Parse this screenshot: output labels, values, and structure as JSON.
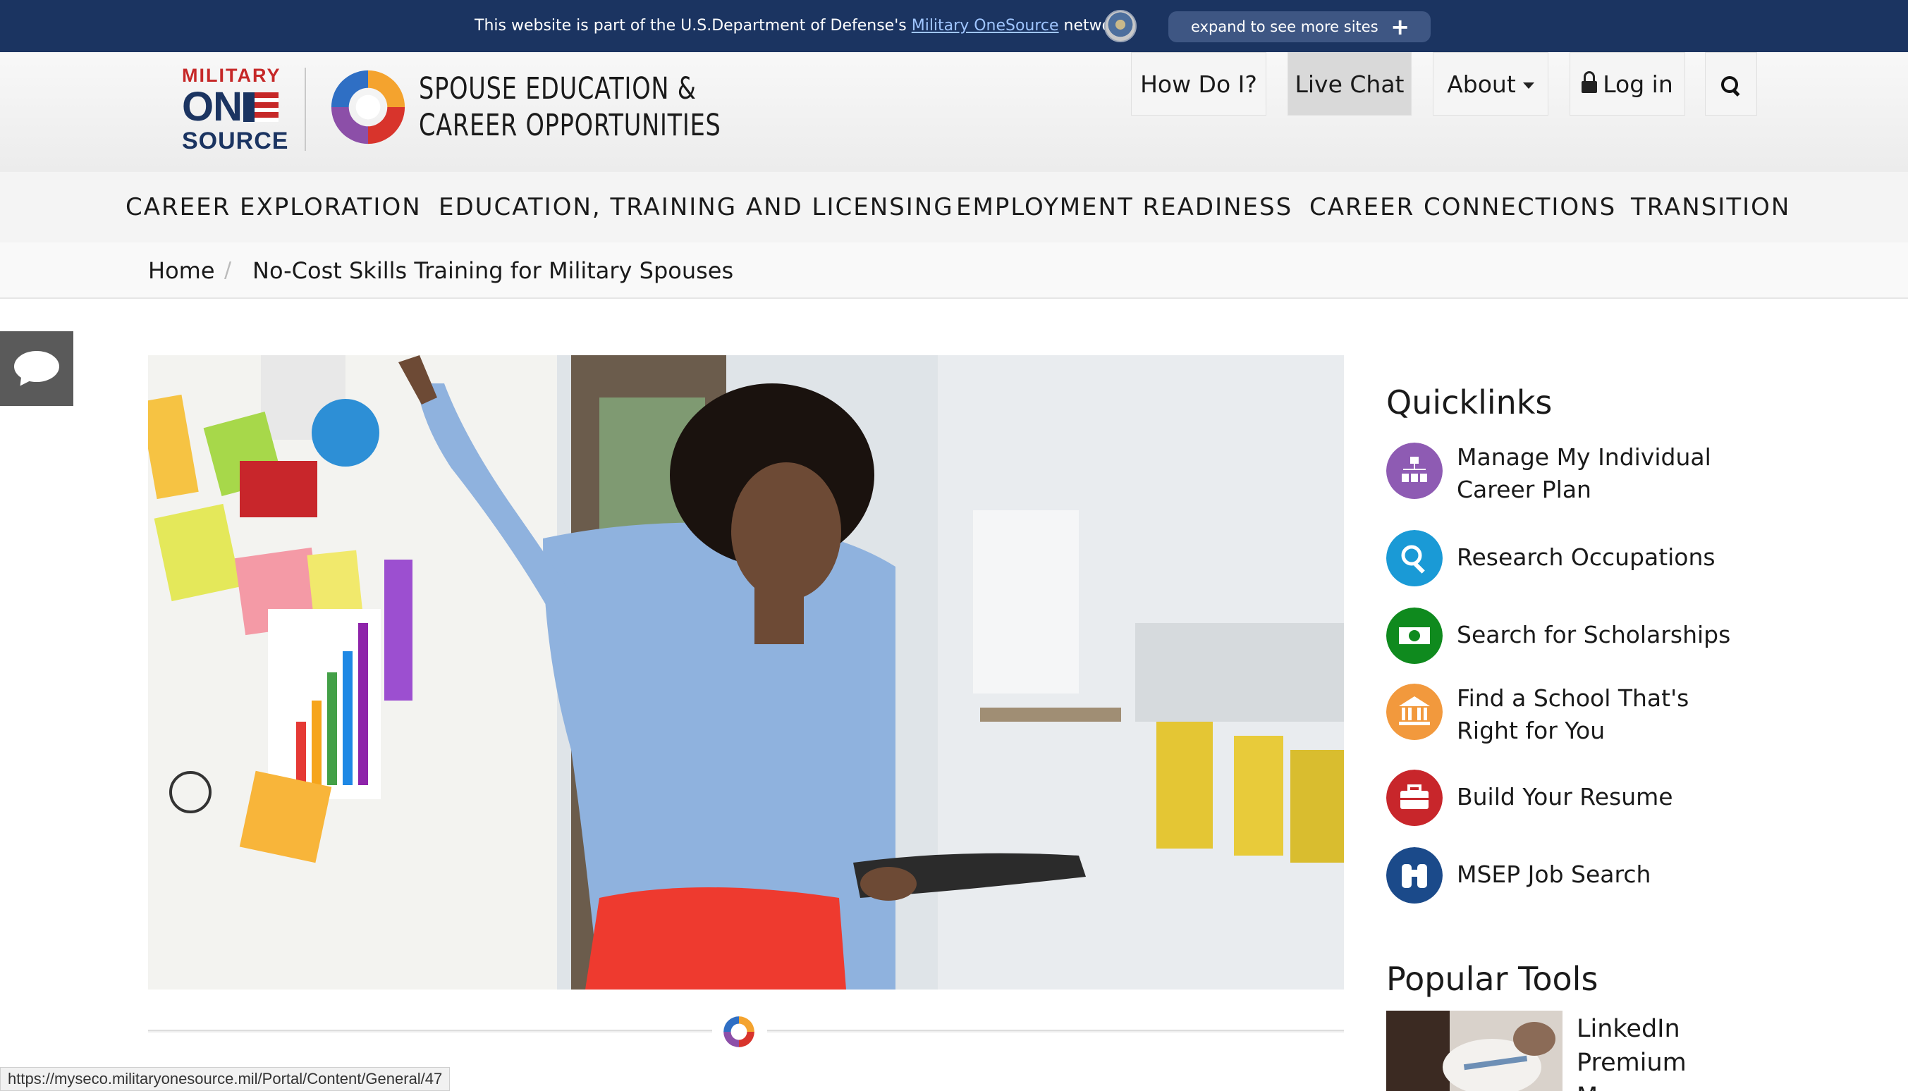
{
  "dod_banner": {
    "text_before": "This website is part of the U.S.Department of Defense's ",
    "link": "Military OneSource",
    "text_after": " network",
    "expand_label": "expand to see more sites",
    "expand_icon": "plus-icon"
  },
  "logo": {
    "military": "MILITARY",
    "one": "ON",
    "source": "SOURCE",
    "seco_line1": "SPOUSE EDUCATION &",
    "seco_line2": "CAREER OPPORTUNITIES"
  },
  "utility_nav": {
    "how_do_i": "How Do I?",
    "live_chat": "Live Chat",
    "about": "About",
    "login": "Log in",
    "search_icon": "search-icon"
  },
  "main_nav": [
    "CAREER EXPLORATION",
    "EDUCATION, TRAINING AND LICENSING",
    "EMPLOYMENT READINESS",
    "CAREER CONNECTIONS",
    "TRANSITION"
  ],
  "breadcrumb": {
    "home": "Home",
    "separator": "/",
    "current": "No-Cost Skills Training for Military Spouses"
  },
  "sidebar": {
    "quicklinks_heading": "Quicklinks",
    "quicklinks": [
      {
        "label": "Manage My Individual Career Plan",
        "icon": "org-chart-icon",
        "color": "#8e5bb3"
      },
      {
        "label": "Research Occupations",
        "icon": "search-icon",
        "color": "#1a9ad6"
      },
      {
        "label": "Search for Scholarships",
        "icon": "money-icon",
        "color": "#0f8a1e"
      },
      {
        "label": "Find a School That's Right for You",
        "icon": "school-icon",
        "color": "#f2993d"
      },
      {
        "label": "Build Your Resume",
        "icon": "briefcase-icon",
        "color": "#c8262b"
      },
      {
        "label": "MSEP Job Search",
        "icon": "binoculars-icon",
        "color": "#1b4a8a"
      }
    ],
    "popular_tools_heading": "Popular Tools",
    "popular_tool_label": "LinkedIn Premium M..."
  },
  "status_url": "https://myseco.militaryonesource.mil/Portal/Content/General/47",
  "colors": {
    "dod_bar": "#1b3461",
    "expand_pill": "#3e5683",
    "brand_red": "#c62828",
    "brand_navy": "#1b3461"
  }
}
